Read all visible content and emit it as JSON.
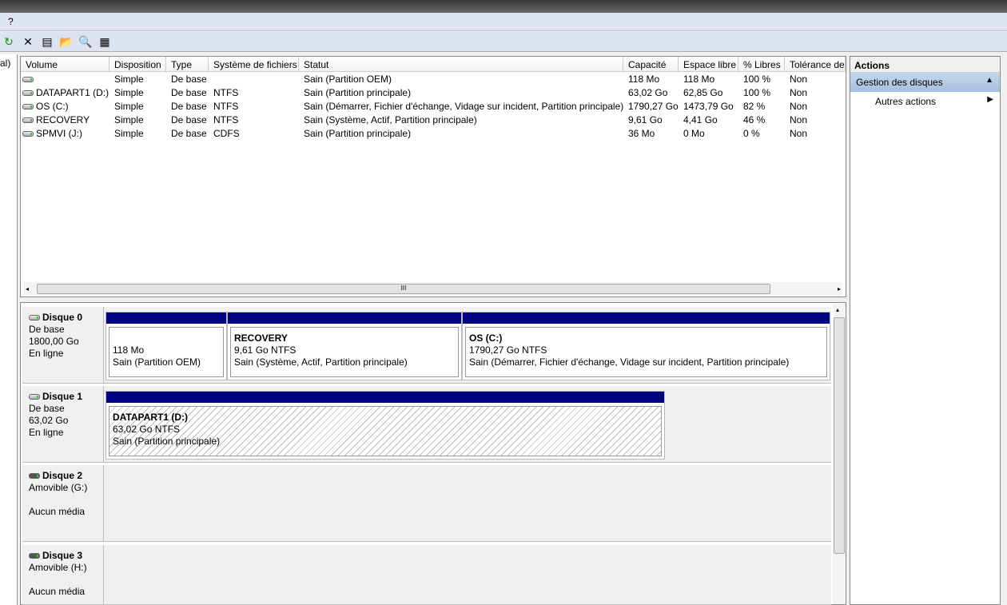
{
  "menu": {
    "help": "?"
  },
  "left_pane": {
    "text": "al)"
  },
  "list": {
    "columns": [
      "Volume",
      "Disposition",
      "Type",
      "Système de fichiers",
      "Statut",
      "Capacité",
      "Espace libre",
      "% Libres",
      "Tolérance de"
    ],
    "rows": [
      [
        "",
        "Simple",
        "De base",
        "",
        "Sain (Partition OEM)",
        "118 Mo",
        "118 Mo",
        "100 %",
        "Non"
      ],
      [
        "DATAPART1 (D:)",
        "Simple",
        "De base",
        "NTFS",
        "Sain (Partition principale)",
        "63,02 Go",
        "62,85 Go",
        "100 %",
        "Non"
      ],
      [
        "OS (C:)",
        "Simple",
        "De base",
        "NTFS",
        "Sain (Démarrer, Fichier d'échange, Vidage sur incident, Partition principale)",
        "1790,27 Go",
        "1473,79 Go",
        "82 %",
        "Non"
      ],
      [
        "RECOVERY",
        "Simple",
        "De base",
        "NTFS",
        "Sain (Système, Actif, Partition principale)",
        "9,61 Go",
        "4,41 Go",
        "46 %",
        "Non"
      ],
      [
        "SPMVI (J:)",
        "Simple",
        "De base",
        "CDFS",
        "Sain (Partition principale)",
        "36 Mo",
        "0 Mo",
        "0 %",
        "Non"
      ]
    ]
  },
  "disks": [
    {
      "name": "Disque 0",
      "type": "De base",
      "size": "1800,00 Go",
      "state": "En ligne",
      "partitions": [
        {
          "name": "",
          "size": "118 Mo",
          "status": "Sain (Partition OEM)"
        },
        {
          "name": "RECOVERY",
          "size": "9,61 Go NTFS",
          "status": "Sain (Système, Actif, Partition principale)"
        },
        {
          "name": "OS  (C:)",
          "size": "1790,27 Go NTFS",
          "status": "Sain (Démarrer, Fichier d'échange, Vidage sur incident, Partition principale)"
        }
      ]
    },
    {
      "name": "Disque 1",
      "type": "De base",
      "size": "63,02 Go",
      "state": "En ligne",
      "partitions": [
        {
          "name": "DATAPART1  (D:)",
          "size": "63,02 Go NTFS",
          "status": "Sain (Partition principale)"
        }
      ]
    },
    {
      "name": "Disque 2",
      "type": "Amovible (G:)",
      "state": "Aucun média"
    },
    {
      "name": "Disque 3",
      "type": "Amovible (H:)",
      "state": "Aucun média"
    }
  ],
  "actions": {
    "title": "Actions",
    "section": "Gestion des disques",
    "item": "Autres actions"
  }
}
